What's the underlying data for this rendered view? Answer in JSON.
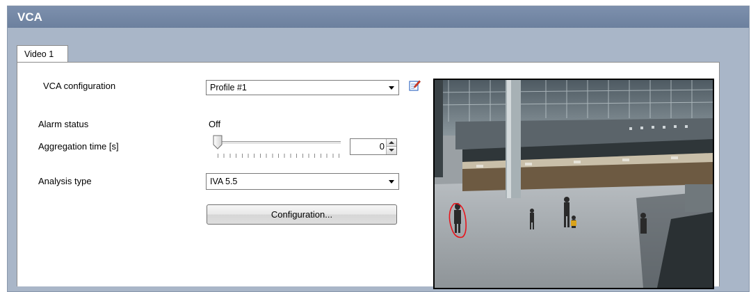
{
  "header": {
    "title": "VCA"
  },
  "tabs": [
    {
      "label": "Video 1"
    }
  ],
  "form": {
    "vca_configuration": {
      "label": "VCA configuration",
      "value": "Profile #1"
    },
    "alarm_status": {
      "label": "Alarm status",
      "value": "Off"
    },
    "aggregation_time": {
      "label": "Aggregation time [s]",
      "value": "0",
      "slider_fraction": 0
    },
    "analysis_type": {
      "label": "Analysis type",
      "value": "IVA 5.5"
    },
    "configuration_button": {
      "label": "Configuration..."
    }
  },
  "icons": {
    "edit": "edit-profile-icon",
    "spin_up": "spin-up-icon",
    "spin_down": "spin-down-icon",
    "dropdown": "chevron-down-icon"
  },
  "colors": {
    "title_bar": "#7286a3",
    "frame": "#a9b6c8",
    "detection_outline": "#e8141b"
  }
}
